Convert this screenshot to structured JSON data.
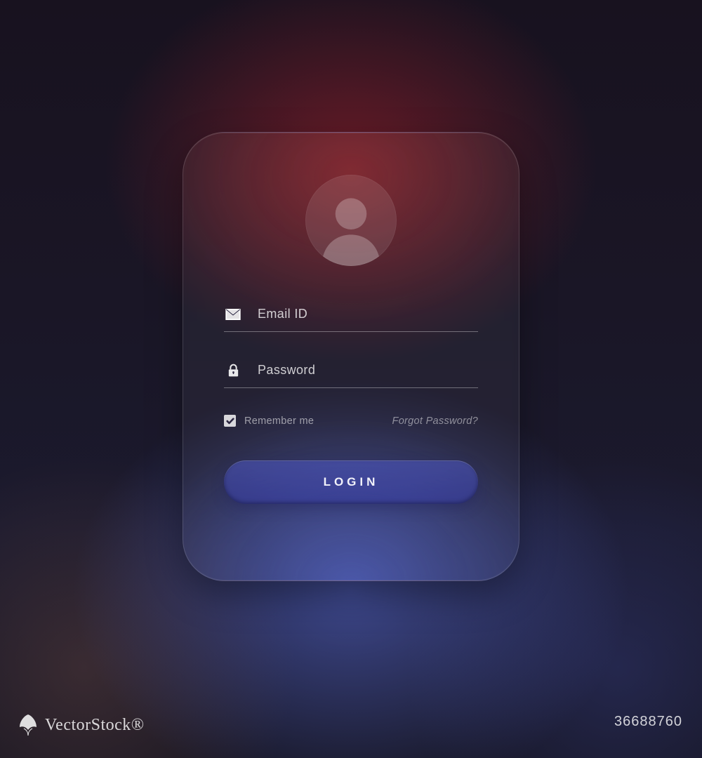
{
  "form": {
    "email_placeholder": "Email ID",
    "password_placeholder": "Password",
    "remember_label": "Remember me",
    "remember_checked": true,
    "forgot_label": "Forgot Password?",
    "login_label": "LOGIN"
  },
  "watermark": {
    "brand": "VectorStock®",
    "id": "36688760"
  },
  "icons": {
    "avatar": "user-icon",
    "email": "envelope-icon",
    "password": "lock-icon",
    "check": "checkmark-icon"
  },
  "colors": {
    "button_bg": "#4c56c0",
    "text_light": "rgba(255,255,255,0.85)"
  }
}
